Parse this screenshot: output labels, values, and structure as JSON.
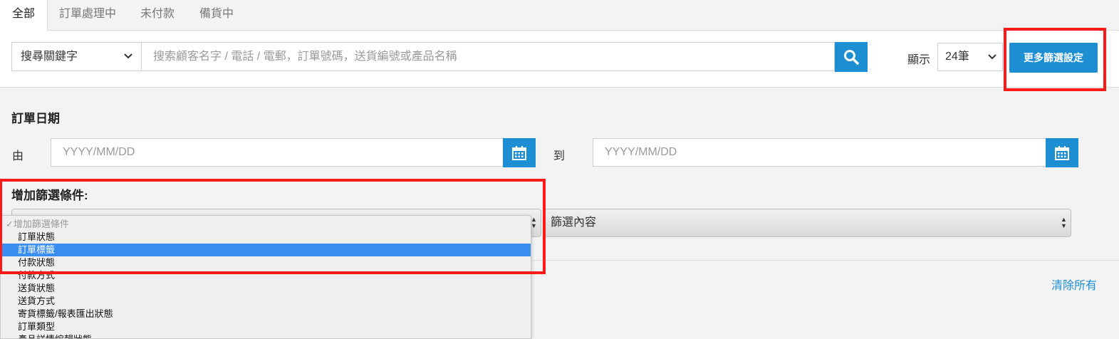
{
  "tabs": [
    {
      "label": "全部"
    },
    {
      "label": "訂單處理中"
    },
    {
      "label": "未付款"
    },
    {
      "label": "備貨中"
    }
  ],
  "search": {
    "keyword_select": "搜尋關鍵字",
    "placeholder": "搜索顧客名字 / 電話 / 電郵，訂單號碼，送貨編號或產品名稱",
    "button_icon": "search-icon"
  },
  "display": {
    "label": "顯示",
    "value": "24筆"
  },
  "more_filters_button": "更多篩選設定",
  "order_date": {
    "title": "訂單日期",
    "from_label": "由",
    "to_label": "到",
    "from_placeholder": "YYYY/MM/DD",
    "to_placeholder": "YYYY/MM/DD",
    "calendar_icon": "calendar-icon"
  },
  "add_filter": {
    "title": "增加篩選條件:",
    "content_select": "篩選內容"
  },
  "dropdown_options": [
    {
      "label": "增加篩選條件",
      "check": "✓"
    },
    {
      "label": "訂單狀態"
    },
    {
      "label": "訂單標籤"
    },
    {
      "label": "付款狀態"
    },
    {
      "label": "付款方式"
    },
    {
      "label": "送貨狀態"
    },
    {
      "label": "送貨方式"
    },
    {
      "label": "寄貨標籤/報表匯出狀態"
    },
    {
      "label": "訂單類型"
    },
    {
      "label": "產品詳情編輯狀態"
    }
  ],
  "clear_all": "清除所有",
  "colors": {
    "accent": "#1d8ed1",
    "highlight": "#3a8ef0",
    "annotation_red": "#ff1a1a"
  }
}
